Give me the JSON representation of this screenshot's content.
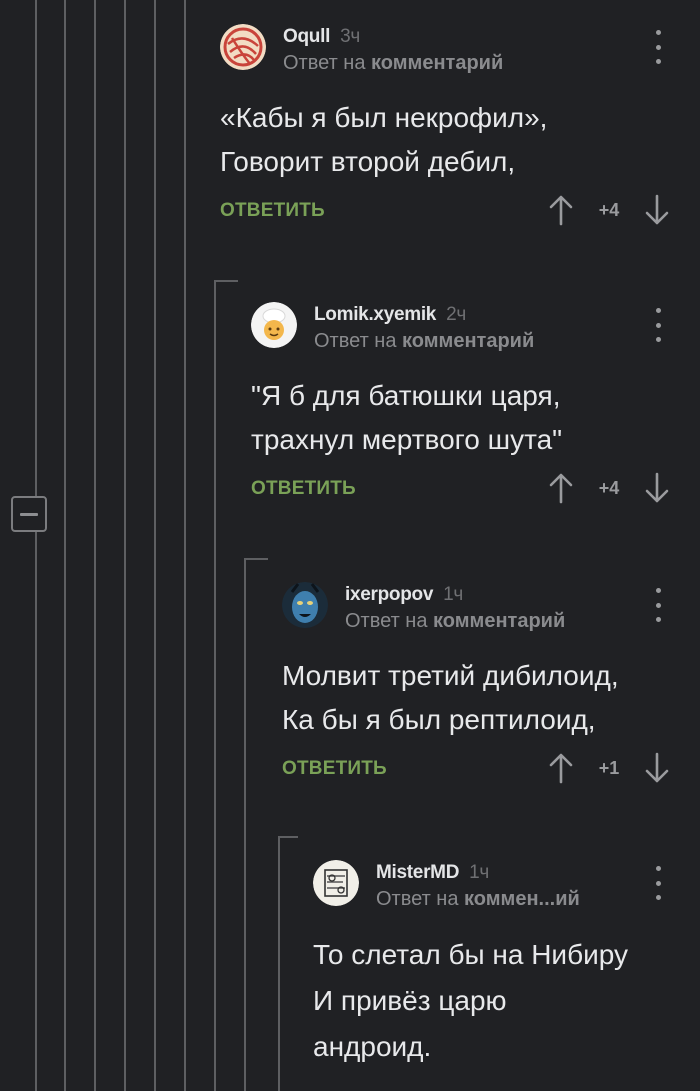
{
  "collapse_label": "−",
  "comments": [
    {
      "username": "Oqull",
      "time": "3ч",
      "reply_prefix": "Ответ на",
      "reply_target": "комментарий",
      "body_lines": [
        "«Кабы я был некрофил»,",
        "Говорит второй дебил,"
      ],
      "reply_label": "ОТВЕТИТЬ",
      "score": "+4",
      "avatar_icon": "pizza-avatar"
    },
    {
      "username": "Lomik.xyemik",
      "time": "2ч",
      "reply_prefix": "Ответ на",
      "reply_target": "комментарий",
      "body_lines": [
        "\"Я б для батюшки царя,",
        "трахнул мертвого шута\""
      ],
      "reply_label": "ОТВЕТИТЬ",
      "score": "+4",
      "avatar_icon": "chef-avatar"
    },
    {
      "username": "ixerpopov",
      "time": "1ч",
      "reply_prefix": "Ответ на",
      "reply_target": "комментарий",
      "body_lines": [
        "Молвит третий дибилоид,",
        "Ка бы я был рептилоид,"
      ],
      "reply_label": "ОТВЕТИТЬ",
      "score": "+1",
      "avatar_icon": "avatar-blue-face"
    },
    {
      "username": "MisterMD",
      "time": "1ч",
      "reply_prefix": "Ответ на",
      "reply_target": "коммен...ий",
      "body_lines": [
        "То слетал бы на Нибиру",
        "И привёз царю",
        "андроид."
      ],
      "avatar_icon": "sketch-avatar"
    }
  ],
  "colors": {
    "background": "#202124",
    "reply_green": "#7aa157",
    "thread_line": "#5e5f62",
    "text": "#e8e9eb",
    "muted": "#8a8b8e"
  }
}
